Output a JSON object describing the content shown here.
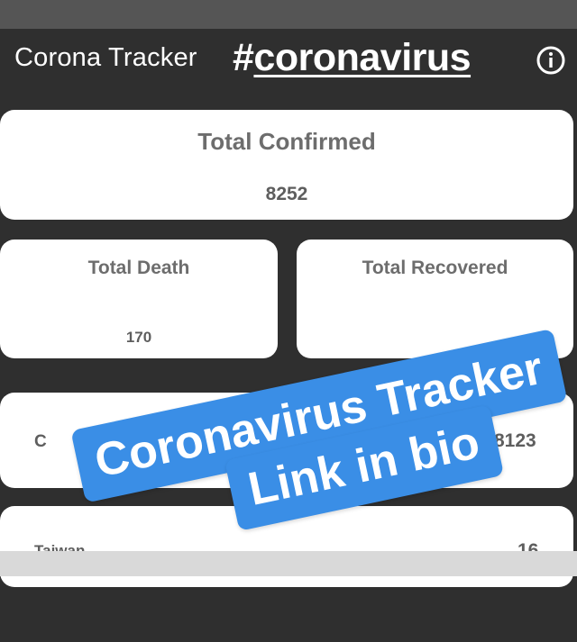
{
  "app": {
    "title": "Corona Tracker",
    "hashtag_symbol": "#",
    "hashtag_word": "coronavirus",
    "info_icon": "info-circle-icon"
  },
  "summary": {
    "confirmed": {
      "label": "Total Confirmed",
      "value": "8252"
    },
    "death": {
      "label": "Total Death",
      "value": "170"
    },
    "recovered": {
      "label": "Total Recovered"
    }
  },
  "countries": [
    {
      "name": "C",
      "count": "8123"
    },
    {
      "name": "Taiwan",
      "count": "16"
    }
  ],
  "overlay": {
    "line1": "Coronavirus Tracker",
    "line2": "Link in bio",
    "color": "#3a8ee6"
  },
  "colors": {
    "background": "#2f2f2f",
    "card": "#ffffff",
    "text_muted": "#6d6d6d"
  }
}
